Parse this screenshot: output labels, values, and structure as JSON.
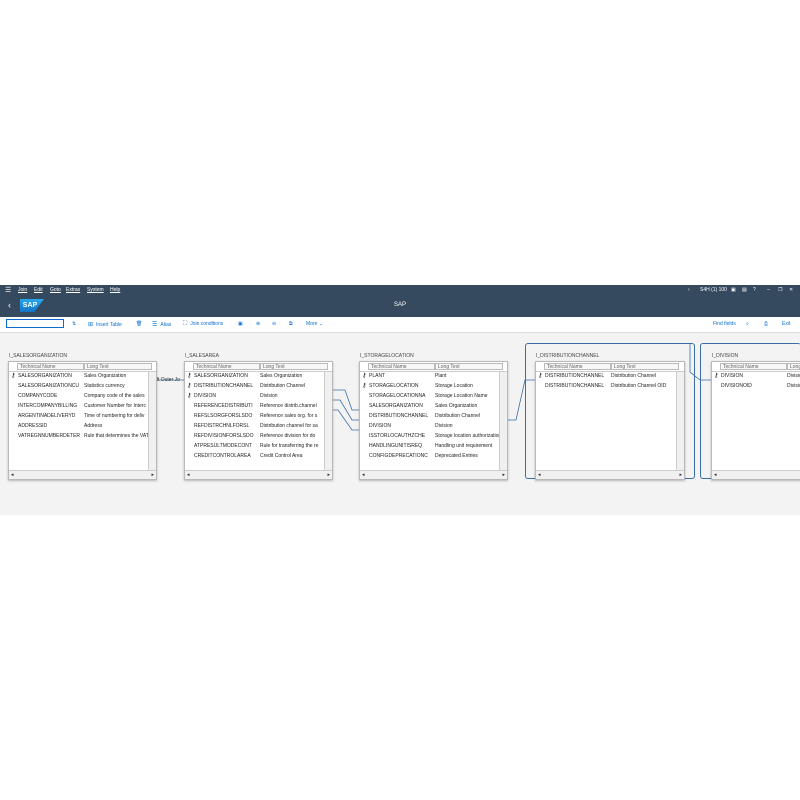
{
  "menu": {
    "items": [
      "Join",
      "Edit",
      "Goto",
      "Extras",
      "System",
      "Help"
    ],
    "system_info": "S4H (1) 100"
  },
  "title": {
    "app": "SAP",
    "logo_text": "SAP"
  },
  "toolbar": {
    "command_value": "",
    "insert_table": "Insert Table",
    "alias": "Alias",
    "join_conditions": "Join conditions",
    "more": "More",
    "find_fields": "Find fields",
    "exit": "Exit"
  },
  "join_label": "Left Outer Jo",
  "tables": [
    {
      "name": "I_SALESORGANIZATION",
      "col1": "Technical Name",
      "col2": "Long Text",
      "rows": [
        {
          "tech": "SALESORGANIZATION",
          "text": "Sales Organization",
          "key": true
        },
        {
          "tech": "SALESORGANIZATIONCU",
          "text": "Statistics currency",
          "key": false
        },
        {
          "tech": "COMPANYCODE",
          "text": "Company code of the sales",
          "key": false
        },
        {
          "tech": "INTERCOMPANYBILLING",
          "text": "Customer Number for Interc",
          "key": false
        },
        {
          "tech": "ARGENTINADELIVERYD",
          "text": "Time of numbering for deliv",
          "key": false
        },
        {
          "tech": "ADDRESSID",
          "text": "Address",
          "key": false
        },
        {
          "tech": "VATREGNNUMBERDETER",
          "text": "Rule that determines the VAT",
          "key": false
        }
      ]
    },
    {
      "name": "I_SALESAREA",
      "col1": "Technical Name",
      "col2": "Long Text",
      "rows": [
        {
          "tech": "SALESORGANIZATION",
          "text": "Sales Organization",
          "key": true
        },
        {
          "tech": "DISTRIBUTIONCHANNEL",
          "text": "Distribution Channel",
          "key": true
        },
        {
          "tech": "DIVISION",
          "text": "Division",
          "key": true
        },
        {
          "tech": "REFERENCEDISTRIBUTI",
          "text": "Reference distrib.channel",
          "key": false
        },
        {
          "tech": "REFSLSORGFORSLSDO",
          "text": "Reference sales org. for s",
          "key": false
        },
        {
          "tech": "REFDISTRCHNLFORSL",
          "text": "Distribution channel for sa",
          "key": false
        },
        {
          "tech": "REFDIVISIONFORSLSDO",
          "text": "Reference division for do",
          "key": false
        },
        {
          "tech": "ATPRESULTMODECONT",
          "text": "Rule for transferring the re",
          "key": false
        },
        {
          "tech": "CREDITCONTROLAREA",
          "text": "Credit Control Area",
          "key": false
        }
      ]
    },
    {
      "name": "I_STORAGELOCATION",
      "col1": "Technical Name",
      "col2": "Long Text",
      "rows": [
        {
          "tech": "PLANT",
          "text": "Plant",
          "key": true
        },
        {
          "tech": "STORAGELOCATION",
          "text": "Storage Location",
          "key": true
        },
        {
          "tech": "STORAGELOCATIONNA",
          "text": "Storage Location Name",
          "key": false
        },
        {
          "tech": "SALESORGANIZATION",
          "text": "Sales Organization",
          "key": false
        },
        {
          "tech": "DISTRIBUTIONCHANNEL",
          "text": "Distribution Channel",
          "key": false
        },
        {
          "tech": "DIVISION",
          "text": "Division",
          "key": false
        },
        {
          "tech": "ISSTORLOCAUTHZCHE",
          "text": "Storage location authorization f",
          "key": false
        },
        {
          "tech": "HANDLINGUNITISREQ",
          "text": "Handling unit requirement",
          "key": false
        },
        {
          "tech": "CONFIGDEPRECATIONC",
          "text": "Deprecated Entries",
          "key": false
        }
      ]
    },
    {
      "name": "I_DISTRIBUTIONCHANNEL",
      "col1": "Technical Name",
      "col2": "Long Text",
      "rows": [
        {
          "tech": "DISTRIBUTIONCHANNEL",
          "text": "Distribution Channel",
          "key": true
        },
        {
          "tech": "DISTRIBUTIONCHANNEL",
          "text": "Distribution Channel OID",
          "key": false
        }
      ]
    },
    {
      "name": "I_DIVISION",
      "col1": "Technical Name",
      "col2": "Long Text",
      "rows": [
        {
          "tech": "DIVISION",
          "text": "Division",
          "key": true
        },
        {
          "tech": "DIVISIONOID",
          "text": "Division O",
          "key": false
        }
      ]
    }
  ],
  "colors": {
    "shell": "#354a5f",
    "link": "#0a6ed1",
    "join_line": "#3a6ea5"
  },
  "icons": [
    "menu-icon",
    "back-icon",
    "key-icon",
    "insert-table-icon",
    "alias-icon",
    "join-conditions-icon",
    "zoom-in-icon",
    "zoom-out-icon",
    "fit-icon",
    "find-icon",
    "print-icon",
    "exit-icon"
  ]
}
